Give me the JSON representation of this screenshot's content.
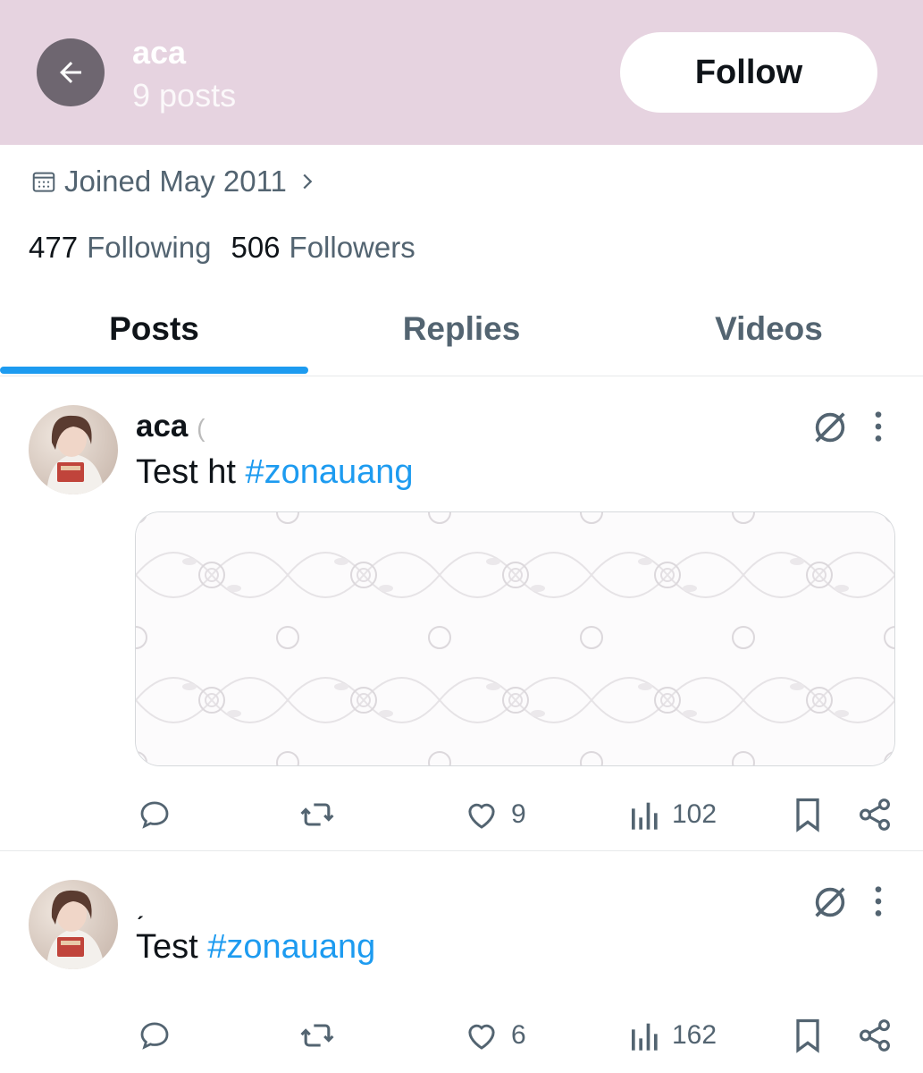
{
  "header": {
    "name": "aca",
    "post_count": "9 posts",
    "follow_label": "Follow",
    "background": "#e6d3e0"
  },
  "profile": {
    "joined": "Joined May 2011",
    "following_count": "477",
    "following_label": "Following",
    "followers_count": "506",
    "followers_label": "Followers"
  },
  "tabs": [
    {
      "label": "Posts",
      "active": true
    },
    {
      "label": "Replies",
      "active": false
    },
    {
      "label": "Videos",
      "active": false
    }
  ],
  "posts": [
    {
      "name": "aca",
      "name_suffix": "(",
      "text": "Test ht ",
      "hashtag": "#zonauang",
      "has_media": true,
      "likes": "9",
      "views": "102"
    },
    {
      "name": "",
      "name_suffix": "ˏ",
      "text": "Test ",
      "hashtag": "#zonauang",
      "has_media": false,
      "likes": "6",
      "views": "162"
    }
  ],
  "icons": {
    "back": "arrow-left-icon",
    "calendar": "calendar-icon",
    "chevron": "chevron-right-icon",
    "grok": "grok-icon",
    "more": "more-vertical-icon",
    "reply": "reply-icon",
    "repost": "repost-icon",
    "like": "heart-icon",
    "views": "views-icon",
    "bookmark": "bookmark-icon",
    "share": "share-icon"
  },
  "colors": {
    "accent": "#1d9bf0",
    "muted": "#536471",
    "text": "#0f1419"
  }
}
